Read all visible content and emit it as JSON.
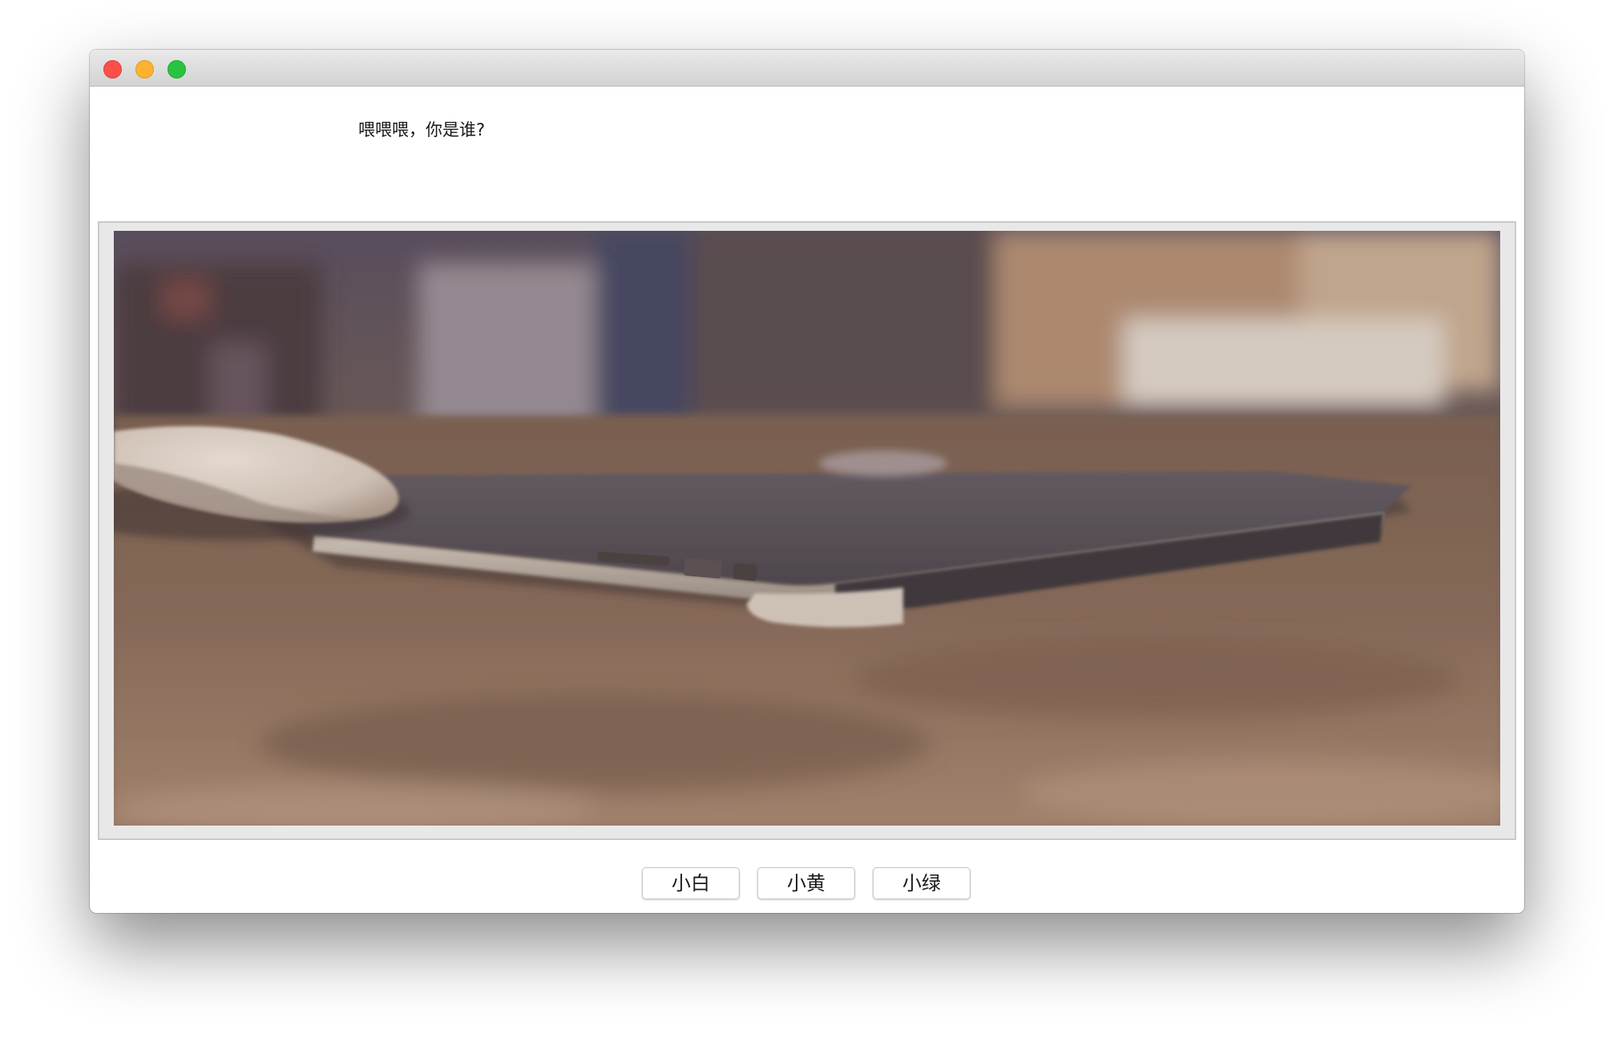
{
  "window": {
    "controls": {
      "close_icon": "close-icon",
      "minimize_icon": "minimize-icon",
      "maximize_icon": "maximize-icon"
    }
  },
  "main": {
    "greeting": "喂喂喂，你是谁?"
  },
  "image": {
    "subject": "laptop-and-mouse-photo"
  },
  "buttons": [
    {
      "label": "小白"
    },
    {
      "label": "小黄"
    },
    {
      "label": "小绿"
    }
  ],
  "colors": {
    "close": "#fc4f4a",
    "minimize": "#fdb22f",
    "maximize": "#2ac33f"
  }
}
